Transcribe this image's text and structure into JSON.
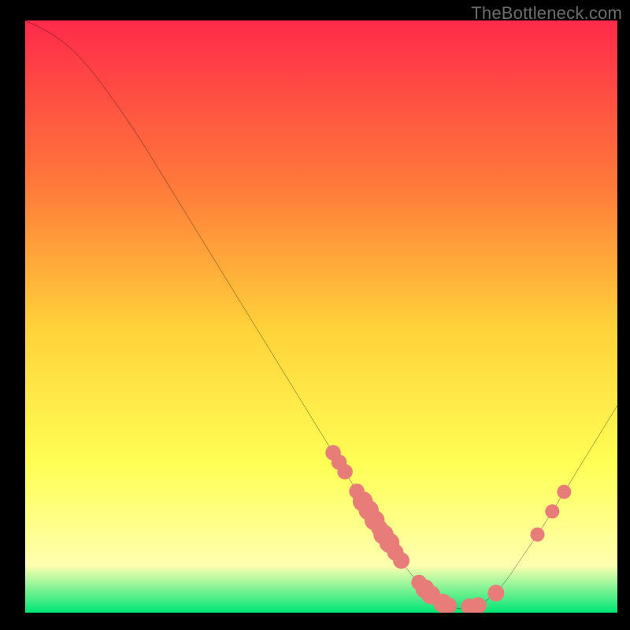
{
  "attribution": "TheBottleneck.com",
  "colors": {
    "frame_bg": "#000000",
    "attribution_text": "#6d6d6d",
    "gradient_top": "#ff2a4a",
    "gradient_mid_upper": "#ff7a3a",
    "gradient_mid": "#ffd23a",
    "gradient_mid_lower": "#ffff55",
    "gradient_lower": "#ffffb0",
    "gradient_bottom": "#00e676",
    "curve": "#000000",
    "marker": "#e77c78"
  },
  "chart_data": {
    "type": "line",
    "title": "",
    "xlabel": "",
    "ylabel": "",
    "xlim": [
      0,
      100
    ],
    "ylim": [
      0,
      100
    ],
    "curve": {
      "x": [
        0,
        4,
        8,
        12,
        16,
        20,
        24,
        28,
        32,
        36,
        40,
        44,
        48,
        52,
        56,
        60,
        64,
        68,
        72,
        76,
        80,
        84,
        88,
        92,
        96,
        100
      ],
      "y": [
        100,
        98,
        95,
        90.5,
        85,
        79,
        72.5,
        66,
        59.5,
        53,
        46.5,
        40,
        33.5,
        27,
        20.5,
        14,
        8,
        3.5,
        1,
        1,
        4,
        9.5,
        15.5,
        22,
        28.5,
        35
      ]
    },
    "markers": [
      {
        "x": 52.0,
        "y": 27.0,
        "r": 1.3
      },
      {
        "x": 53.0,
        "y": 25.4,
        "r": 1.3
      },
      {
        "x": 54.0,
        "y": 23.8,
        "r": 1.3
      },
      {
        "x": 56.0,
        "y": 20.5,
        "r": 1.3
      },
      {
        "x": 57.0,
        "y": 18.8,
        "r": 1.7
      },
      {
        "x": 58.0,
        "y": 17.3,
        "r": 1.7
      },
      {
        "x": 59.0,
        "y": 15.6,
        "r": 1.7
      },
      {
        "x": 59.8,
        "y": 14.3,
        "r": 1.4
      },
      {
        "x": 60.5,
        "y": 13.2,
        "r": 1.7
      },
      {
        "x": 61.5,
        "y": 11.8,
        "r": 1.7
      },
      {
        "x": 62.5,
        "y": 10.2,
        "r": 1.4
      },
      {
        "x": 63.5,
        "y": 8.8,
        "r": 1.4
      },
      {
        "x": 66.5,
        "y": 5.1,
        "r": 1.3
      },
      {
        "x": 67.5,
        "y": 4.0,
        "r": 1.6
      },
      {
        "x": 68.5,
        "y": 3.0,
        "r": 1.6
      },
      {
        "x": 70.5,
        "y": 1.6,
        "r": 1.6
      },
      {
        "x": 71.5,
        "y": 1.2,
        "r": 1.4
      },
      {
        "x": 75.0,
        "y": 1.0,
        "r": 1.4
      },
      {
        "x": 76.5,
        "y": 1.2,
        "r": 1.4
      },
      {
        "x": 79.5,
        "y": 3.3,
        "r": 1.4
      },
      {
        "x": 86.5,
        "y": 13.2,
        "r": 1.2
      },
      {
        "x": 89.0,
        "y": 17.1,
        "r": 1.2
      },
      {
        "x": 91.0,
        "y": 20.4,
        "r": 1.2
      }
    ]
  }
}
